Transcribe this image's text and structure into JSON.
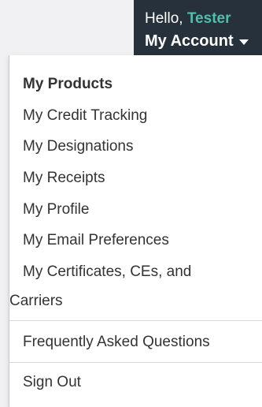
{
  "header": {
    "greeting_prefix": "Hello, ",
    "user_name": "Tester",
    "account_label": "My Account"
  },
  "colors": {
    "header_bg": "#27313c",
    "accent": "#4fbfa9",
    "menu_text": "#333333"
  },
  "menu": {
    "products": "My Products",
    "credit_tracking": "My Credit Tracking",
    "designations": "My Designations",
    "receipts": "My Receipts",
    "profile": "My Profile",
    "email_preferences": "My Email Preferences",
    "certificates_line1": "My Certificates, CEs, and",
    "certificates_line2": "Carriers",
    "faq": "Frequently Asked Questions",
    "sign_out": "Sign Out"
  }
}
